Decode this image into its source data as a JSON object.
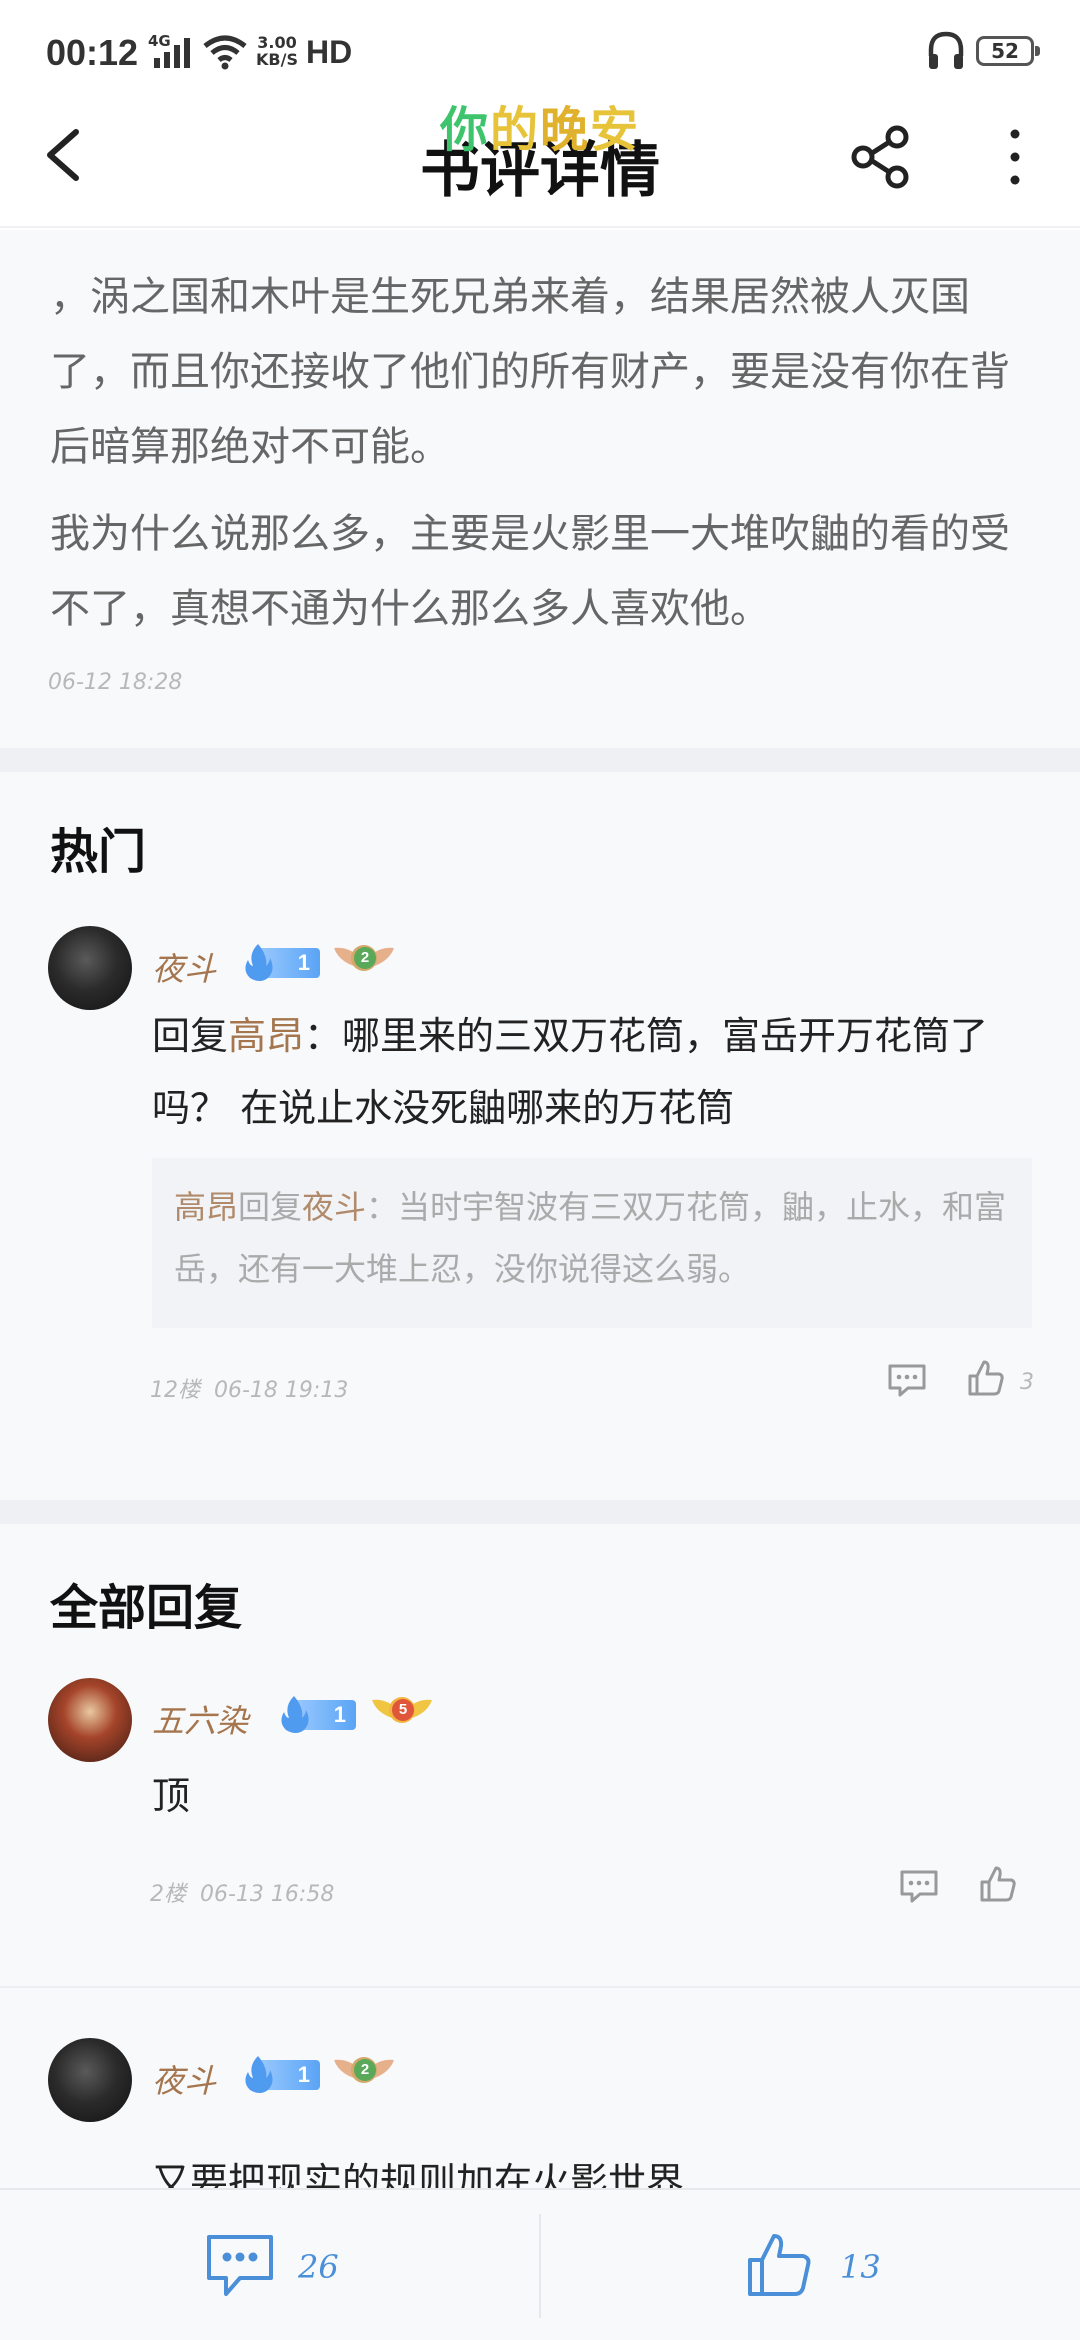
{
  "status_bar": {
    "time": "00:12",
    "network": "4G",
    "speed_value": "3.00",
    "speed_unit": "KB/S",
    "hd": "HD",
    "battery": "52"
  },
  "header": {
    "title": "书评详情",
    "watermark_chars": [
      "你",
      "的",
      "晚",
      "安"
    ],
    "watermark_colors": [
      "#3ec46d",
      "#e7c33a",
      "#e0b12c",
      "#e7c33a"
    ]
  },
  "review": {
    "paragraphs": [
      "，涡之国和木叶是生死兄弟来着，结果居然被人灭国了，而且你还接收了他们的所有财产，要是没有你在背后暗算那绝对不可能。",
      "我为什么说那么多，主要是火影里一大堆吹鼬的看的受不了，真想不通为什么那么多人喜欢他。"
    ],
    "time": "06-12  18:28"
  },
  "hot": {
    "title": "热门",
    "comment": {
      "username": "夜斗",
      "fan_level": "1",
      "rank": "2",
      "reply_prefix": "回复",
      "reply_target": "高昂",
      "text": "：哪里来的三双万花筒，富岳开万花筒了吗？  在说止水没死鼬哪来的万花筒",
      "quote_user": "高昂",
      "quote_mid": "回复",
      "quote_target": "夜斗",
      "quote_text": "：当时宇智波有三双万花筒，鼬，止水，和富岳，还有一大堆上忍，没你说得这么弱。",
      "floor": "12楼",
      "time": "06-18  19:13",
      "likes": "3"
    }
  },
  "all": {
    "title": "全部回复",
    "comments": [
      {
        "username": "五六染",
        "fan_level": "1",
        "rank": "5",
        "text": "顶",
        "floor": "2楼",
        "time": "06-13  16:58"
      },
      {
        "username": "夜斗",
        "fan_level": "1",
        "rank": "2",
        "text": "又要把现实的规则加在火影世界"
      }
    ]
  },
  "bottom_bar": {
    "comment_count": "26",
    "like_count": "13"
  },
  "colors": {
    "accent_blue": "#4a8fd8",
    "username_brown": "#a5754e"
  }
}
